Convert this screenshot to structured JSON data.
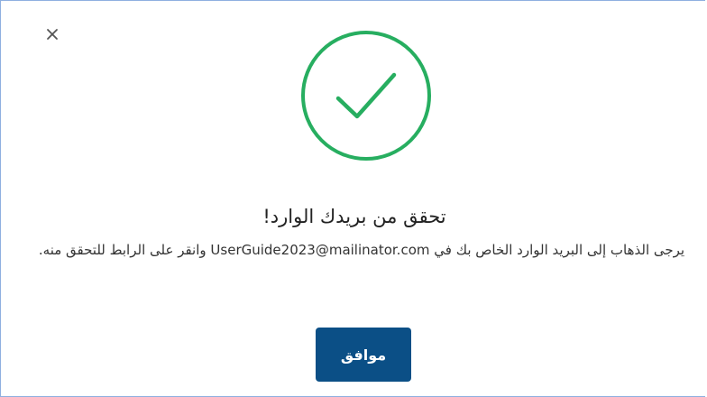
{
  "dialog": {
    "close_icon": "close-icon",
    "status_icon": "check-circle-icon",
    "accent_color": "#27ae60",
    "title": "تحقق من بريدك الوارد!",
    "message_before_email": "يرجى الذهاب إلى البريد الوارد الخاص بك في ",
    "email": "UserGuide2023@mailinator.com",
    "message_after_email": " وانقر على الرابط للتحقق منه.",
    "ok_label": "موافق",
    "ok_color": "#0b4f86"
  }
}
